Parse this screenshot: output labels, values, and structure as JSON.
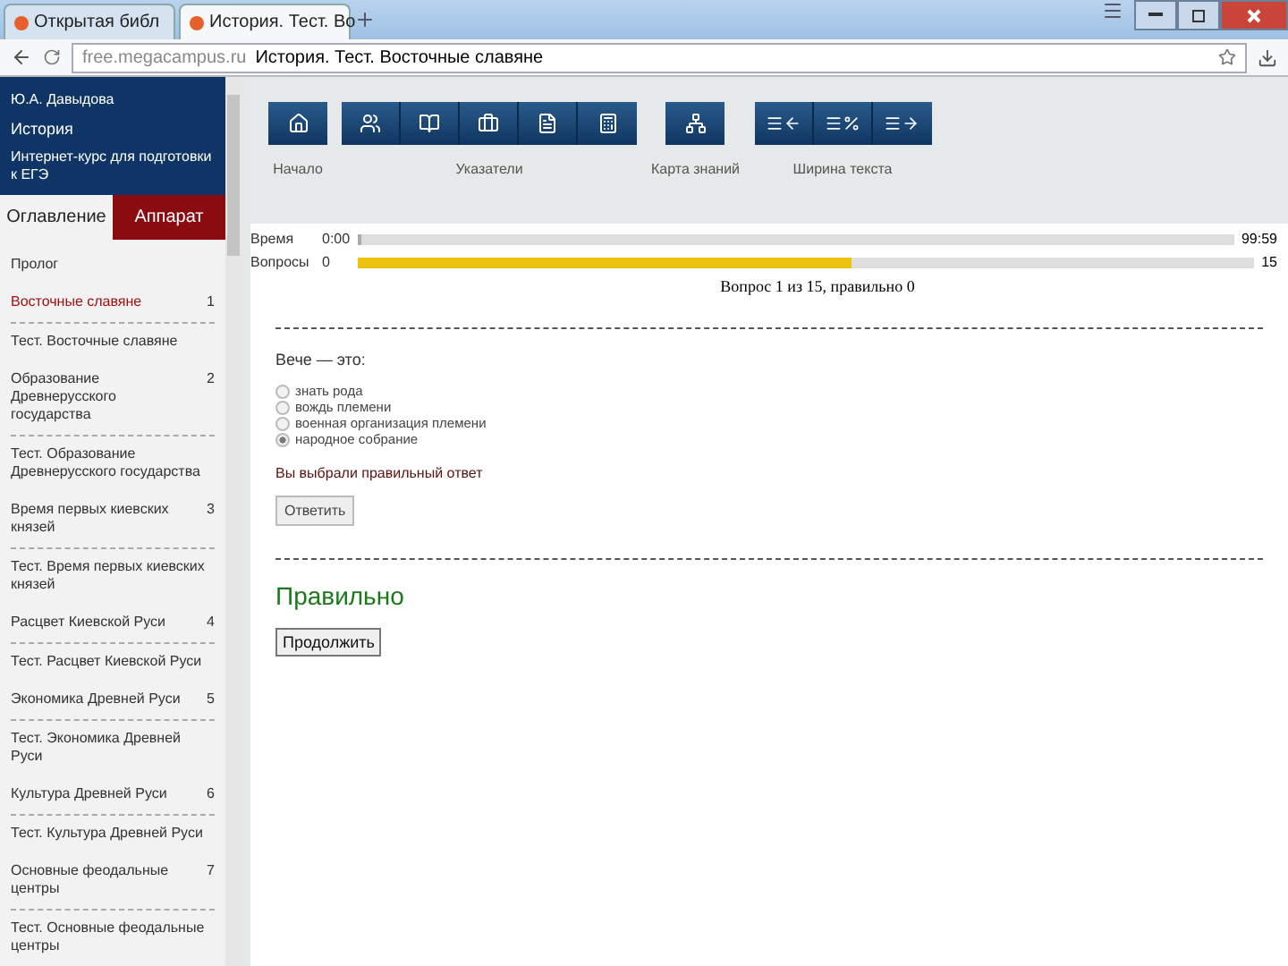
{
  "browser": {
    "tabs": [
      {
        "label": "Открытая библ",
        "selected": false
      },
      {
        "label": "История. Тест. Во",
        "selected": true
      }
    ],
    "address": {
      "host": "free.megacampus.ru",
      "title": "История. Тест. Восточные славяне"
    }
  },
  "sidebar": {
    "author": "Ю.А. Давыдова",
    "subject": "История",
    "course": "Интернет-курс для подготовки к ЕГЭ",
    "tabs": [
      {
        "label": "Оглавление",
        "selected": false
      },
      {
        "label": "Аппарат",
        "selected": true
      }
    ],
    "items": [
      {
        "label": "Пролог",
        "selected": false
      },
      {
        "label": "Восточные славяне",
        "number": "1",
        "selected": true
      },
      {
        "label": "Тест. Восточные славяне",
        "selected": false
      },
      {
        "label": "Образование Древнерусского государства",
        "number": "2",
        "selected": false
      },
      {
        "label": "Тест. Образование Древнерусского государства",
        "selected": false
      },
      {
        "label": "Время первых киевских князей",
        "number": "3",
        "selected": false
      },
      {
        "label": "Тест. Время первых киевских князей",
        "selected": false
      },
      {
        "label": "Расцвет Киевской Руси",
        "number": "4",
        "selected": false
      },
      {
        "label": "Тест. Расцвет Киевской Руси",
        "selected": false
      },
      {
        "label": "Экономика Древней Руси",
        "number": "5",
        "selected": false
      },
      {
        "label": "Тест. Экономика Древней Руси",
        "selected": false
      },
      {
        "label": "Культура Древней Руси",
        "number": "6",
        "selected": false
      },
      {
        "label": "Тест. Культура Древней Руси",
        "selected": false
      },
      {
        "label": "Основные феодальные центры",
        "number": "7",
        "selected": false
      },
      {
        "label": "Тест. Основные феодальные центры",
        "selected": false
      }
    ]
  },
  "toolbar": [
    {
      "label": "Начало",
      "buttons": [
        {
          "kind": "home"
        }
      ]
    },
    {
      "label": "Указатели",
      "buttons": [
        {
          "kind": "users"
        },
        {
          "kind": "book"
        },
        {
          "kind": "briefcase"
        },
        {
          "kind": "file"
        },
        {
          "kind": "calculator"
        }
      ]
    },
    {
      "label": "Карта знаний",
      "buttons": [
        {
          "kind": "network"
        }
      ]
    },
    {
      "label": "Ширина текста",
      "buttons": [
        {
          "kind": "narrow"
        },
        {
          "kind": "percent"
        },
        {
          "kind": "wide"
        }
      ]
    }
  ],
  "progress": [
    {
      "label": "Время",
      "start": "0:00",
      "end": "99:59",
      "level": 0.004
    },
    {
      "label": "Вопросы",
      "start": "0",
      "end": "15",
      "level": 0.55
    }
  ],
  "summary": "Вопрос 1 из 15, правильно 0",
  "question": {
    "text": "Вече — это:",
    "options": [
      {
        "label": "знать рода",
        "selected": false
      },
      {
        "label": "вождь племени",
        "selected": false
      },
      {
        "label": "военная организация племени",
        "selected": false
      },
      {
        "label": "народное собрание",
        "selected": true
      }
    ],
    "feedback": "Вы выбрали правильный ответ",
    "answer_button": "Ответить",
    "result": "Правильно",
    "continue_button": "Продолжить"
  }
}
